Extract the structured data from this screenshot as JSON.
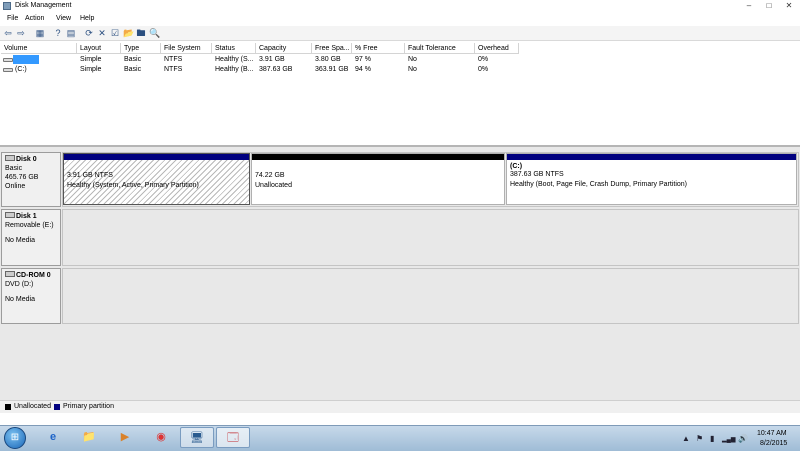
{
  "window": {
    "title": "Disk Management",
    "controls": {
      "minimize": "–",
      "maximize": "□",
      "close": "✕"
    }
  },
  "menu": [
    "File",
    "Action",
    "View",
    "Help"
  ],
  "toolbar": {
    "back": "⇦",
    "forward": "⇨",
    "console_tree": "▦",
    "help": "?",
    "props": "▤",
    "refresh": "⟳",
    "delete": "✕",
    "check": "☑",
    "open": "📂",
    "explore": "🖿",
    "query": "🔍",
    "settings": "▣"
  },
  "volume_list": {
    "columns": [
      "Volume",
      "Layout",
      "Type",
      "File System",
      "Status",
      "Capacity",
      "Free Spa...",
      "% Free",
      "Fault Tolerance",
      "Overhead"
    ],
    "rows": [
      {
        "volume": "",
        "layout": "Simple",
        "type": "Basic",
        "fs": "NTFS",
        "status": "Healthy (S...",
        "capacity": "3.91 GB",
        "free": "3.80 GB",
        "pct": "97 %",
        "fault": "No",
        "overhead": "0%"
      },
      {
        "volume": "(C:)",
        "layout": "Simple",
        "type": "Basic",
        "fs": "NTFS",
        "status": "Healthy (B...",
        "capacity": "387.63 GB",
        "free": "363.91 GB",
        "pct": "94 %",
        "fault": "No",
        "overhead": "0%"
      }
    ]
  },
  "disks": [
    {
      "name": "Disk 0",
      "kind": "Basic",
      "size": "465.76 GB",
      "state": "Online",
      "partitions": [
        {
          "title": "",
          "line1": "3.91 GB NTFS",
          "line2": "Healthy (System, Active, Primary Partition)"
        },
        {
          "title": "",
          "line1": "74.22 GB",
          "line2": "Unallocated"
        },
        {
          "title": "(C:)",
          "line1": "387.63 GB NTFS",
          "line2": "Healthy (Boot, Page File, Crash Dump, Primary Partition)"
        }
      ]
    },
    {
      "name": "Disk 1",
      "kind": "Removable (E:)",
      "state": "No Media"
    },
    {
      "name": "CD-ROM 0",
      "kind": "DVD (D:)",
      "state": "No Media"
    }
  ],
  "legend": [
    {
      "label": "Unallocated",
      "color": "#000000"
    },
    {
      "label": "Primary partition",
      "color": "#00007f"
    }
  ],
  "taskbar": {
    "start": "⊞",
    "apps": [
      "e",
      "📁",
      "▶",
      "◉",
      "🖥",
      "🗔"
    ],
    "tray": {
      "chevron": "▲",
      "flag": "⚑",
      "battery": "▮",
      "network": "▂▄▆",
      "volume": "🔊"
    },
    "clock": {
      "time": "10:47 AM",
      "date": "8/2/2015"
    }
  },
  "colors": {
    "primary": "#00007f",
    "unallocated": "#000000",
    "selection": "#3399ff"
  }
}
